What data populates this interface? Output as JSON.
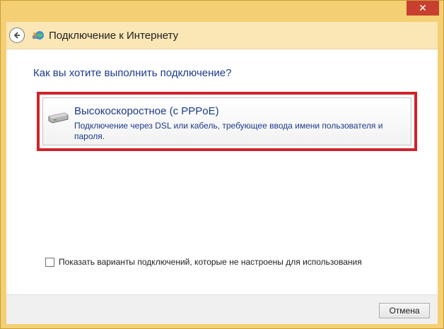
{
  "window": {
    "close_label": "✕"
  },
  "header": {
    "title": "Подключение к Интернету"
  },
  "main": {
    "question": "Как вы хотите выполнить подключение?",
    "option": {
      "title": "Высокоскоростное (с PPPoE)",
      "description": "Подключение через DSL или кабель, требующее ввода имени пользователя и пароля."
    },
    "show_options_label": "Показать варианты подключений, которые не настроены для использования"
  },
  "footer": {
    "cancel_label": "Отмена"
  },
  "colors": {
    "titlebar": "#f5cf74",
    "accent_text": "#1b3a8a",
    "highlight_border": "#d0222a",
    "close_button": "#c7402f"
  }
}
